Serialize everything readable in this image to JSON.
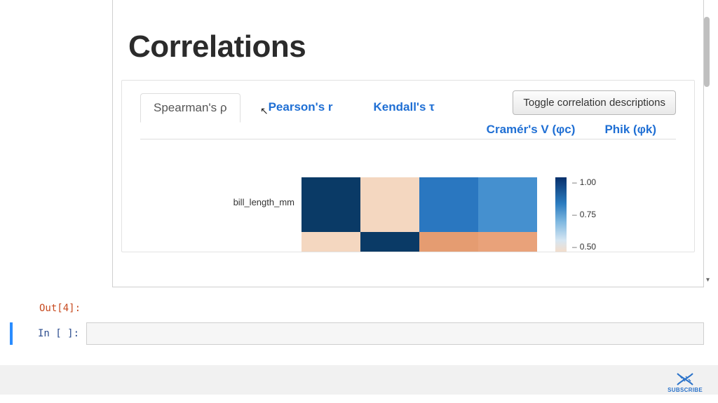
{
  "heading": "Correlations",
  "tabs": {
    "spearman": "Spearman's ρ",
    "pearson": "Pearson's r",
    "kendall": "Kendall's τ",
    "cramers": "Cramér's V (φc)",
    "phik": "Phik (φk)"
  },
  "toggle_button": "Toggle correlation descriptions",
  "row_label": "bill_length_mm",
  "colorbar_ticks": [
    "1.00",
    "0.75",
    "0.50"
  ],
  "prompts": {
    "out": "Out[4]:",
    "in": "In [ ]:"
  },
  "subscribe_label": "SUBSCRIBE",
  "chart_data": {
    "type": "heatmap",
    "title": "Spearman's ρ correlation heatmap",
    "rows_visible": [
      "bill_length_mm",
      ""
    ],
    "columns_count": 4,
    "colorscale": "RdBu-like (navy high → peach low)",
    "colorbar_range_visible": [
      0.5,
      1.0
    ],
    "cells": [
      {
        "row": 0,
        "col": 0,
        "approx_value": 1.0,
        "color": "#0a3a66"
      },
      {
        "row": 0,
        "col": 1,
        "approx_value": 0.2,
        "color": "#f4d7c0"
      },
      {
        "row": 0,
        "col": 2,
        "approx_value": 0.65,
        "color": "#2a77c0"
      },
      {
        "row": 0,
        "col": 3,
        "approx_value": 0.6,
        "color": "#4590cf"
      },
      {
        "row": 1,
        "col": 0,
        "approx_value": 0.2,
        "color": "#f4d7c0"
      },
      {
        "row": 1,
        "col": 1,
        "approx_value": 1.0,
        "color": "#0a3a66"
      },
      {
        "row": 1,
        "col": 2,
        "approx_value": 0.1,
        "color": "#e59c71"
      },
      {
        "row": 1,
        "col": 3,
        "approx_value": 0.1,
        "color": "#e9a27a"
      }
    ]
  }
}
